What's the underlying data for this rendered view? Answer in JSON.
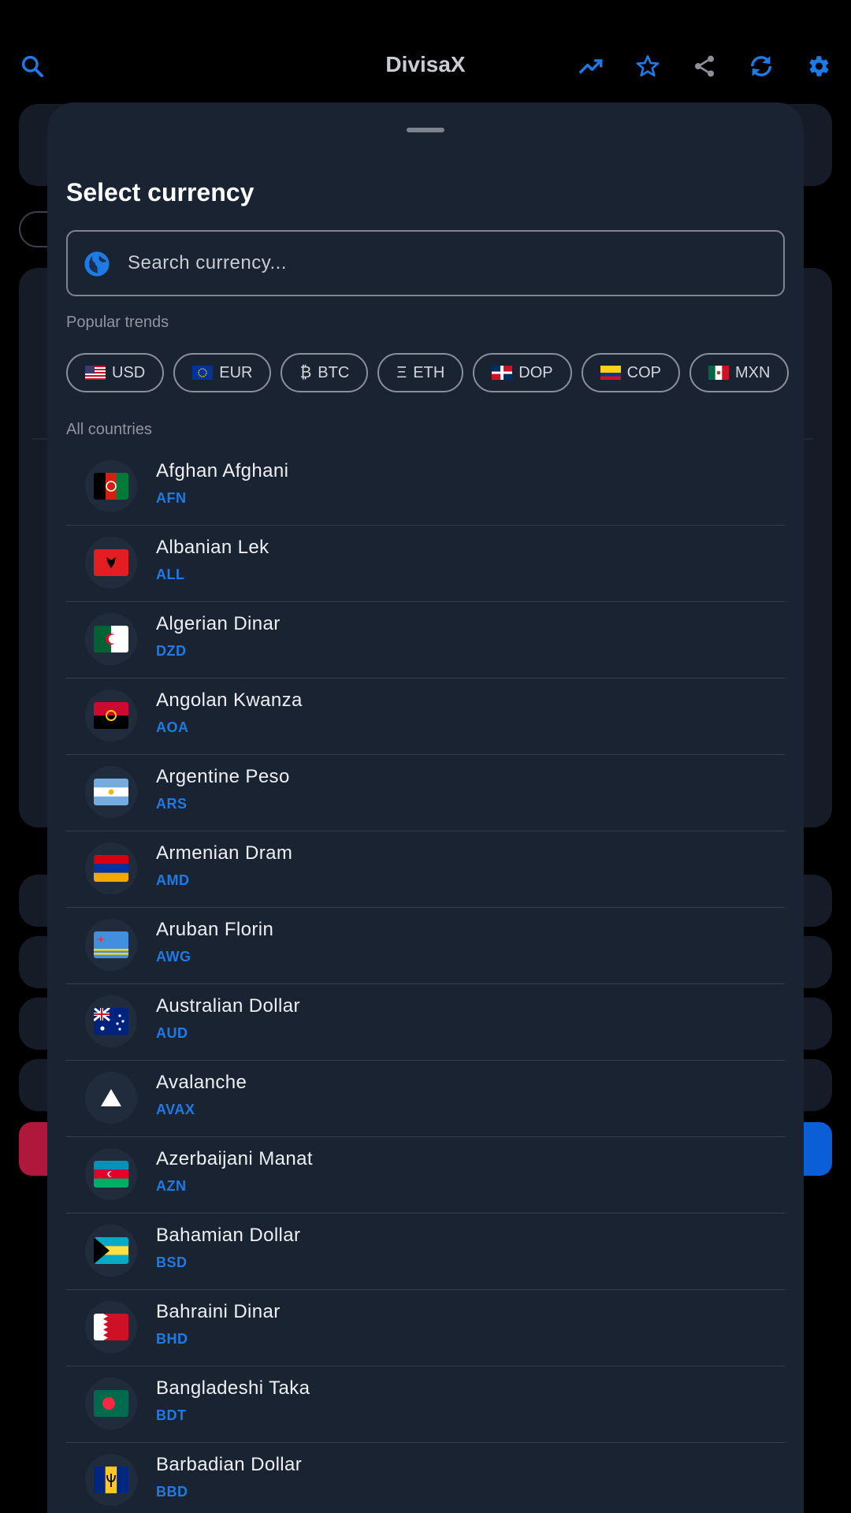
{
  "app": {
    "title": "DivisaX"
  },
  "sheet": {
    "title": "Select currency",
    "search_placeholder": "Search currency...",
    "popular_label": "Popular trends",
    "all_label": "All countries"
  },
  "popular": [
    {
      "flag": "🇺🇸",
      "code": "USD"
    },
    {
      "flag": "🇪🇺",
      "code": "EUR"
    },
    {
      "flag": "₿",
      "code": "BTC"
    },
    {
      "flag": "Ξ",
      "code": "ETH"
    },
    {
      "flag": "🇩🇴",
      "code": "DOP"
    },
    {
      "flag": "🇨🇴",
      "code": "COP"
    },
    {
      "flag": "🇲🇽",
      "code": "MXN"
    }
  ],
  "currencies": [
    {
      "name": "Afghan Afghani",
      "code": "AFN"
    },
    {
      "name": "Albanian Lek",
      "code": "ALL"
    },
    {
      "name": "Algerian Dinar",
      "code": "DZD"
    },
    {
      "name": "Angolan Kwanza",
      "code": "AOA"
    },
    {
      "name": "Argentine Peso",
      "code": "ARS"
    },
    {
      "name": "Armenian Dram",
      "code": "AMD"
    },
    {
      "name": "Aruban Florin",
      "code": "AWG"
    },
    {
      "name": "Australian Dollar",
      "code": "AUD"
    },
    {
      "name": "Avalanche",
      "code": "AVAX"
    },
    {
      "name": "Azerbaijani Manat",
      "code": "AZN"
    },
    {
      "name": "Bahamian Dollar",
      "code": "BSD"
    },
    {
      "name": "Bahraini Dinar",
      "code": "BHD"
    },
    {
      "name": "Bangladeshi Taka",
      "code": "BDT"
    },
    {
      "name": "Barbadian Dollar",
      "code": "BBD"
    }
  ],
  "colors": {
    "accent": "#1e7be6",
    "sheet": "#1a2332",
    "background": "#000000"
  }
}
